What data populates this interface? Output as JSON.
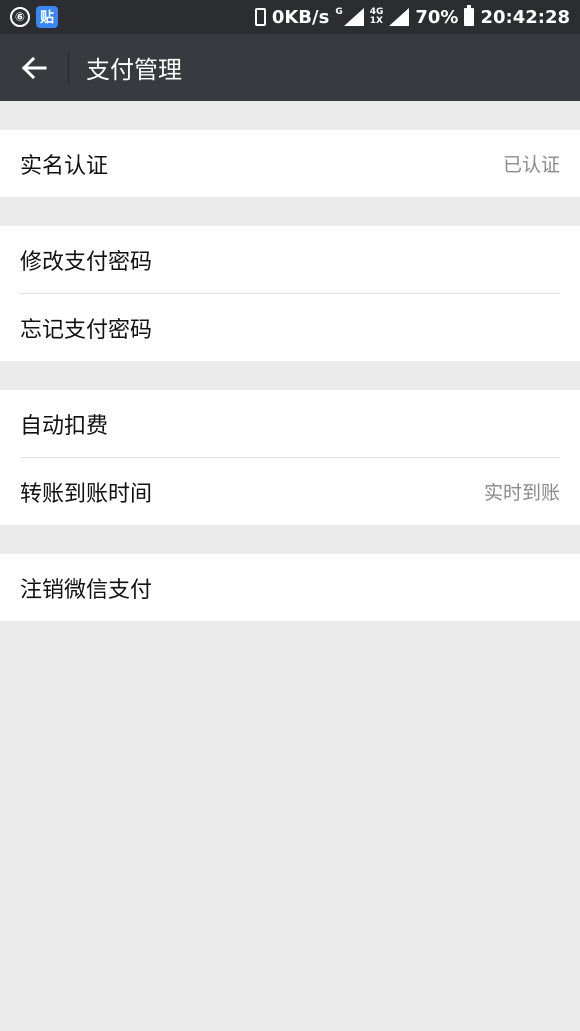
{
  "status_bar": {
    "left_icons": [
      "netease-music-icon",
      "tieba-icon"
    ],
    "tieba_glyph": "贴",
    "netease_glyph": "⑥",
    "speed": "0KB/s",
    "net_g": "G",
    "net_4g_top": "4G",
    "net_4g_bottom": "1X",
    "battery": "70%",
    "time": "20:42:28"
  },
  "header": {
    "title": "支付管理"
  },
  "groups": [
    {
      "items": [
        {
          "label": "实名认证",
          "value": "已认证"
        }
      ]
    },
    {
      "items": [
        {
          "label": "修改支付密码",
          "value": ""
        },
        {
          "label": "忘记支付密码",
          "value": ""
        }
      ]
    },
    {
      "items": [
        {
          "label": "自动扣费",
          "value": ""
        },
        {
          "label": "转账到账时间",
          "value": "实时到账"
        }
      ]
    },
    {
      "items": [
        {
          "label": "注销微信支付",
          "value": ""
        }
      ]
    }
  ],
  "colors": {
    "statusbar_bg": "#2c2d30",
    "titlebar_bg": "#393a3f",
    "page_bg": "#ebebeb"
  }
}
